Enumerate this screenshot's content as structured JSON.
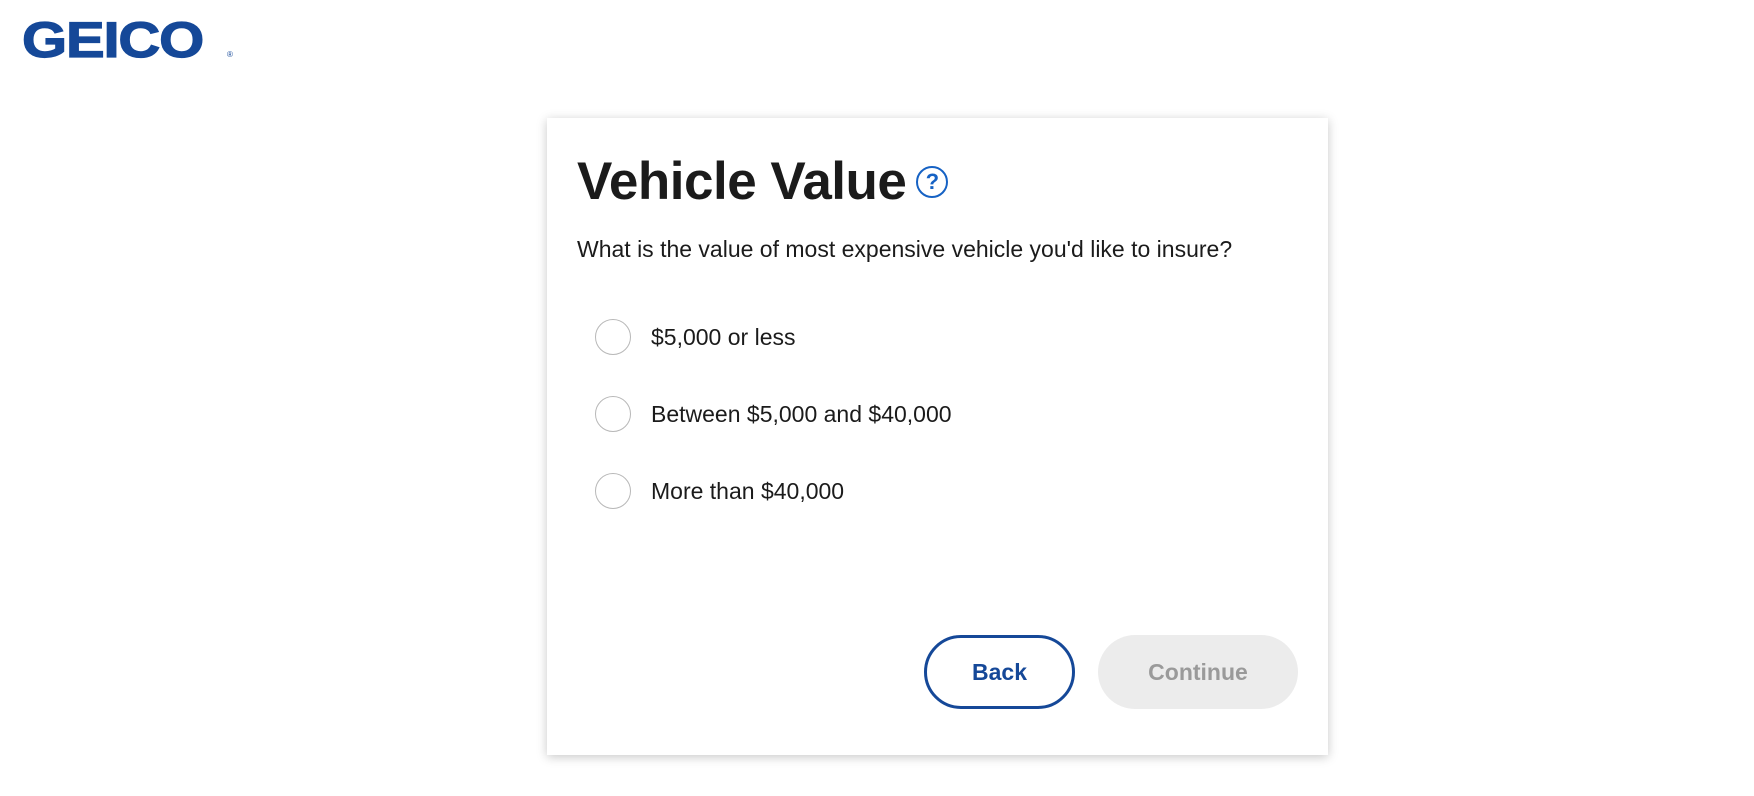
{
  "brand": {
    "logo_text": "GEICO",
    "registered_mark": "®",
    "color": "#154898"
  },
  "question": {
    "title": "Vehicle Value",
    "help_icon": "question-mark-icon",
    "help_glyph": "?",
    "prompt": "What is the value of most expensive vehicle you'd like to insure?"
  },
  "options": [
    {
      "label": "$5,000 or less",
      "selected": false
    },
    {
      "label": "Between $5,000 and $40,000",
      "selected": false
    },
    {
      "label": "More than $40,000",
      "selected": false
    }
  ],
  "actions": {
    "back_label": "Back",
    "continue_label": "Continue",
    "continue_enabled": false
  },
  "colors": {
    "accent": "#154898",
    "help_icon": "#1662c4",
    "disabled_bg": "#ececec",
    "disabled_text": "#9a9a9a"
  }
}
